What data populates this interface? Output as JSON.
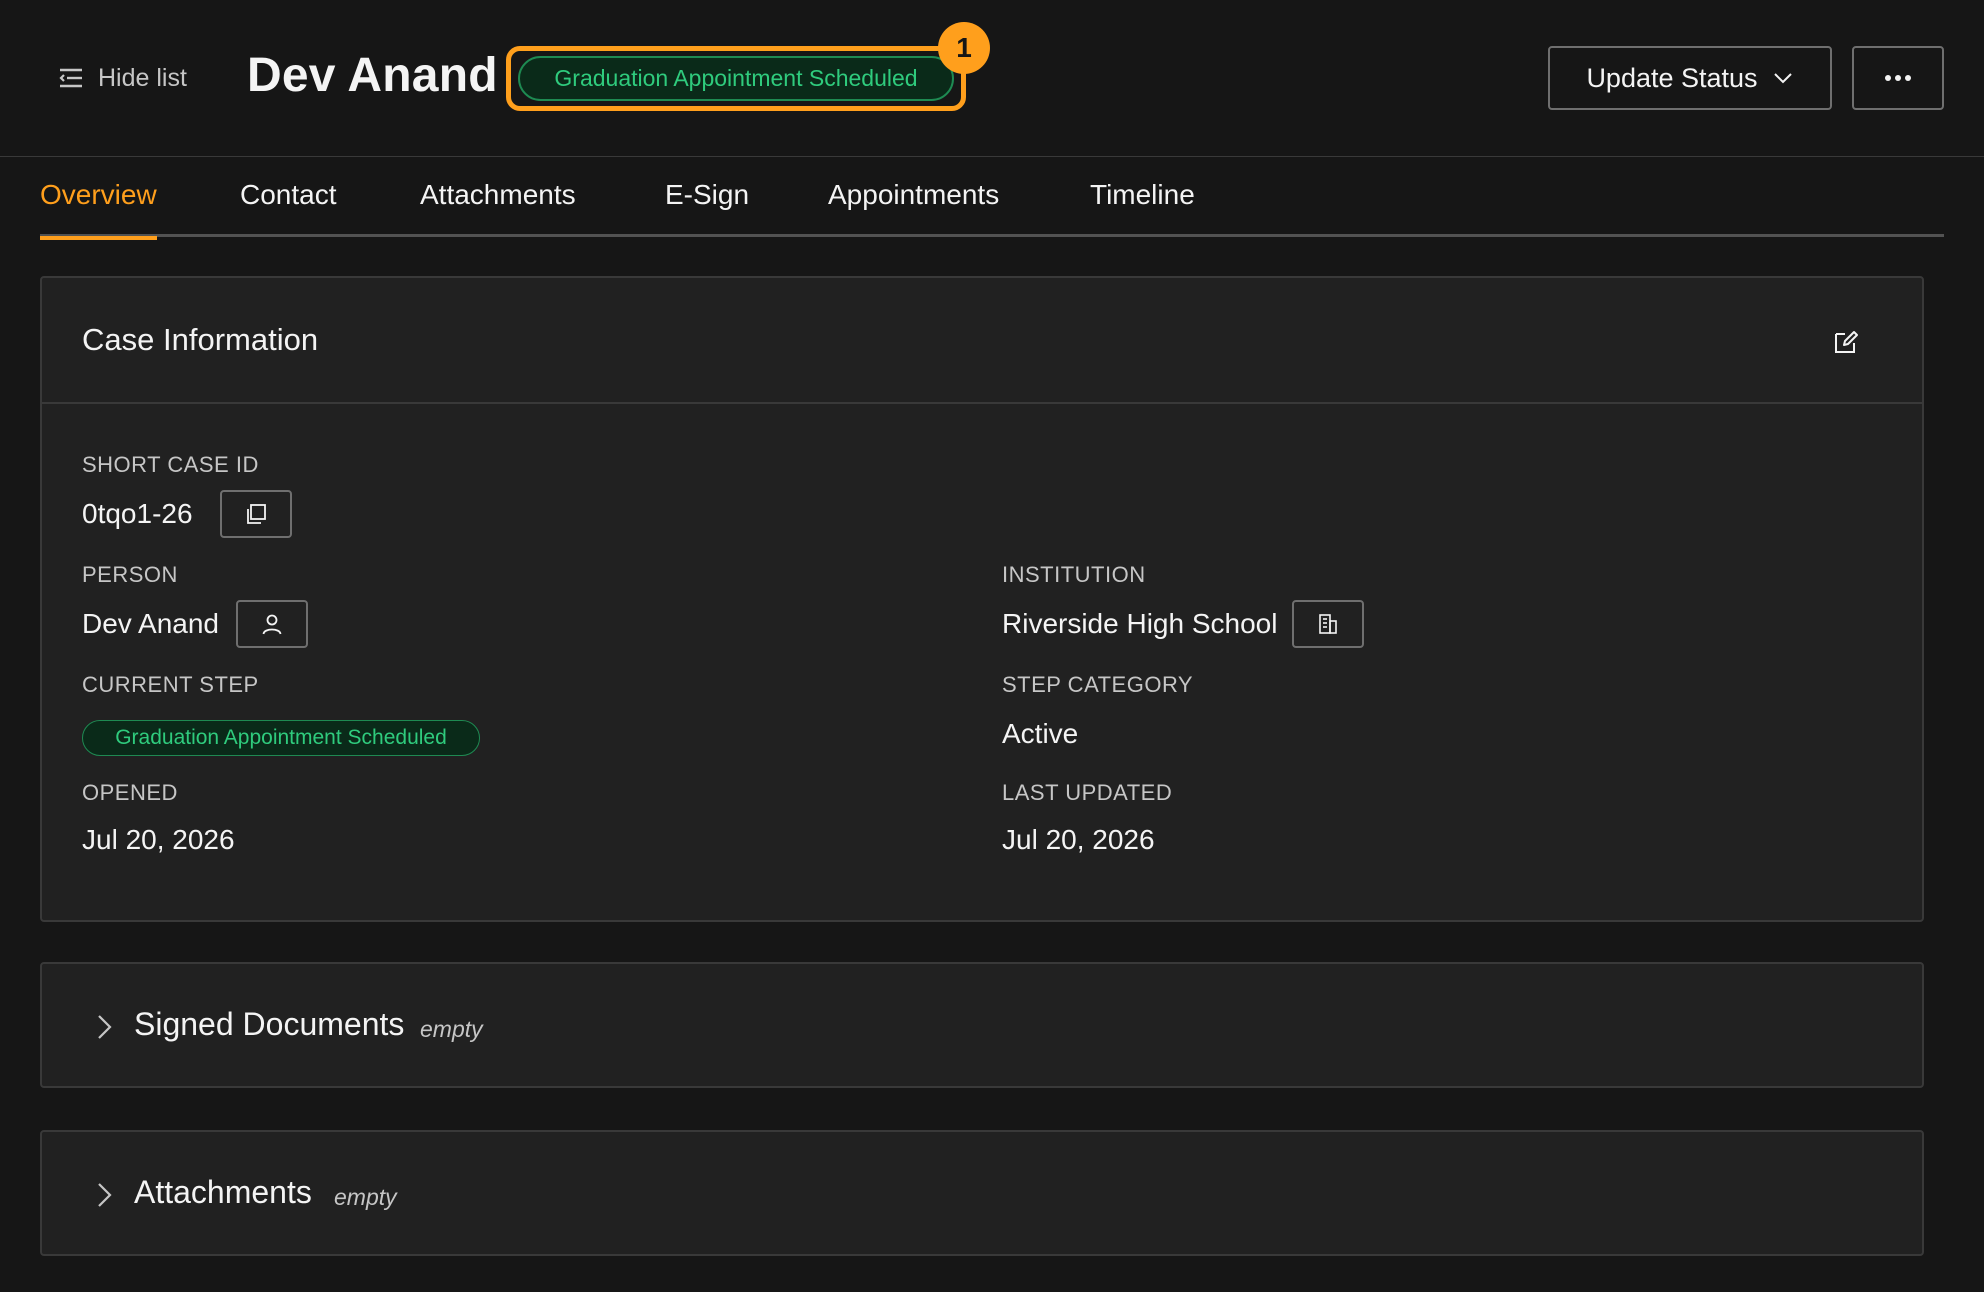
{
  "header": {
    "hide_list_label": "Hide list",
    "title": "Dev Anand",
    "status": "Graduation Appointment Scheduled",
    "highlight_badge": "1",
    "update_status_label": "Update Status",
    "more_icon": "overflow-menu-icon"
  },
  "tabs": [
    {
      "label": "Overview",
      "active": true
    },
    {
      "label": "Contact",
      "active": false
    },
    {
      "label": "Attachments",
      "active": false
    },
    {
      "label": "E-Sign",
      "active": false
    },
    {
      "label": "Appointments",
      "active": false
    },
    {
      "label": "Timeline",
      "active": false
    }
  ],
  "case_info": {
    "title": "Case Information",
    "short_case_id_label": "SHORT CASE ID",
    "short_case_id": "0tqo1-26",
    "person_label": "PERSON",
    "person": "Dev Anand",
    "institution_label": "INSTITUTION",
    "institution": "Riverside High School",
    "current_step_label": "CURRENT STEP",
    "current_step": "Graduation Appointment Scheduled",
    "step_category_label": "STEP CATEGORY",
    "step_category": "Active",
    "opened_label": "OPENED",
    "opened": "Jul 20, 2026",
    "last_updated_label": "LAST UPDATED",
    "last_updated": "Jul 20, 2026"
  },
  "sections": [
    {
      "title": "Signed Documents",
      "status": "empty"
    },
    {
      "title": "Attachments",
      "status": "empty"
    }
  ],
  "colors": {
    "accent": "#ff9f1c",
    "success_text": "#2fcb7d",
    "background": "#161616",
    "card": "#212121"
  }
}
